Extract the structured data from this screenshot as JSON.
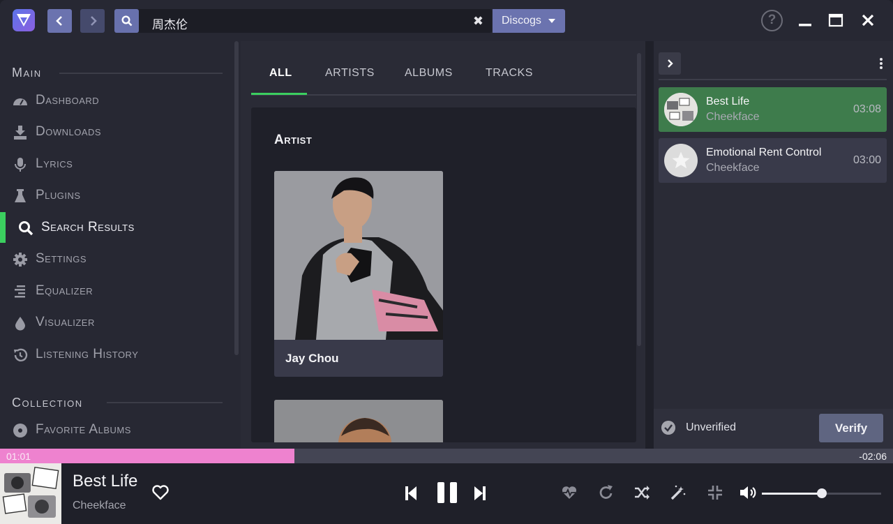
{
  "colors": {
    "accent_green": "#3bcf5f",
    "accent_purple": "#6b73af",
    "progress_pink": "#ee82cf",
    "playing_row": "#3e7c4c"
  },
  "search": {
    "query": "周杰伦",
    "provider": "Discogs"
  },
  "sidebar": {
    "main_heading": "Main",
    "collection_heading": "Collection",
    "items": [
      {
        "label": "Dashboard",
        "icon": "dashboard-icon"
      },
      {
        "label": "Downloads",
        "icon": "download-icon"
      },
      {
        "label": "Lyrics",
        "icon": "microphone-icon"
      },
      {
        "label": "Plugins",
        "icon": "flask-icon"
      },
      {
        "label": "Search Results",
        "icon": "search-icon",
        "active": true
      },
      {
        "label": "Settings",
        "icon": "gear-icon"
      },
      {
        "label": "Equalizer",
        "icon": "equalizer-icon"
      },
      {
        "label": "Visualizer",
        "icon": "droplet-icon"
      },
      {
        "label": "Listening History",
        "icon": "history-icon"
      }
    ],
    "collection_items": [
      {
        "label": "Favorite Albums",
        "icon": "disc-icon"
      }
    ]
  },
  "main": {
    "tabs": [
      "ALL",
      "ARTISTS",
      "ALBUMS",
      "TRACKS"
    ],
    "active_tab": "ALL",
    "section_title": "Artist",
    "artists": [
      {
        "name": "Jay Chou"
      }
    ]
  },
  "queue": {
    "items": [
      {
        "title": "Best Life",
        "artist": "Cheekface",
        "duration": "03:08",
        "playing": true
      },
      {
        "title": "Emotional Rent Control",
        "artist": "Cheekface",
        "duration": "03:00",
        "playing": false
      }
    ],
    "verify_status": "Unverified",
    "verify_button": "Verify"
  },
  "player": {
    "current_time": "01:01",
    "remaining_time": "-02:06",
    "progress_fraction": 0.33,
    "title": "Best Life",
    "artist": "Cheekface",
    "volume_fraction": 0.5
  }
}
